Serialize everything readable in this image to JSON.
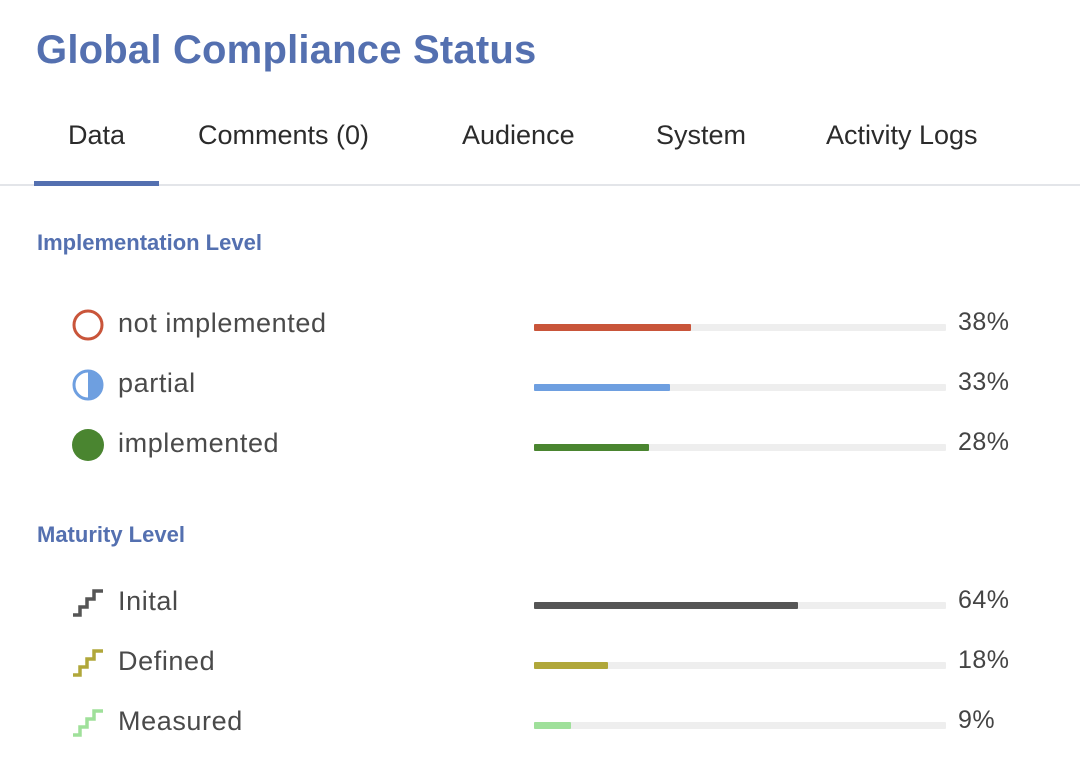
{
  "page": {
    "title": "Global Compliance Status"
  },
  "tabs": [
    {
      "label": "Data",
      "active": true
    },
    {
      "label": "Comments (0)",
      "active": false
    },
    {
      "label": "Audience",
      "active": false
    },
    {
      "label": "System",
      "active": false
    },
    {
      "label": "Activity Logs",
      "active": false
    }
  ],
  "implementation": {
    "heading": "Implementation Level",
    "rows": [
      {
        "label": "not implemented",
        "value": "38%",
        "fraction": 0.38,
        "icon": "empty-circle-icon",
        "color": "#c9553a"
      },
      {
        "label": "partial",
        "value": "33%",
        "fraction": 0.33,
        "icon": "half-circle-icon",
        "color": "#6e9fe0"
      },
      {
        "label": "implemented",
        "value": "28%",
        "fraction": 0.28,
        "icon": "filled-circle-icon",
        "color": "#4a8530"
      }
    ]
  },
  "maturity": {
    "heading": "Maturity Level",
    "rows": [
      {
        "label": "Inital",
        "value": "64%",
        "fraction": 0.64,
        "icon": "steps-icon",
        "color": "#555555"
      },
      {
        "label": "Defined",
        "value": "18%",
        "fraction": 0.18,
        "icon": "steps-icon",
        "color": "#b0a73a"
      },
      {
        "label": "Measured",
        "value": "9%",
        "fraction": 0.09,
        "icon": "steps-icon",
        "color": "#9fe09a"
      }
    ]
  }
}
